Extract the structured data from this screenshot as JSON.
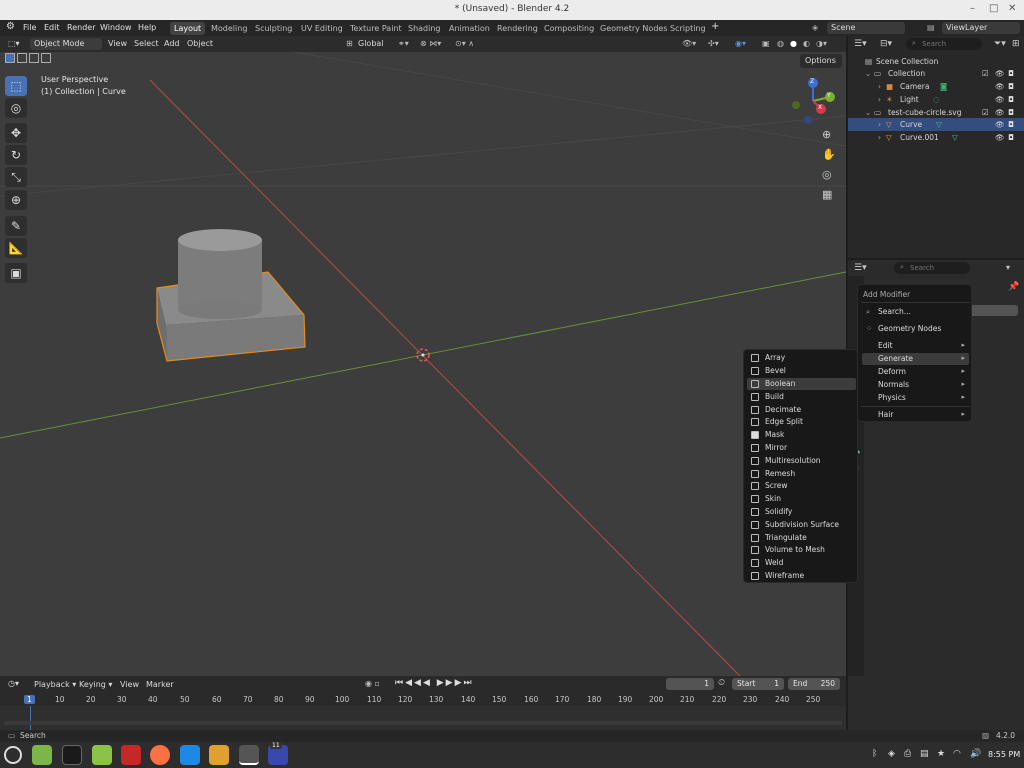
{
  "window": {
    "title": "* (Unsaved) - Blender 4.2"
  },
  "menubar": {
    "items": [
      "File",
      "Edit",
      "Render",
      "Window",
      "Help"
    ],
    "workspaces": [
      "Layout",
      "Modeling",
      "Sculpting",
      "UV Editing",
      "Texture Paint",
      "Shading",
      "Animation",
      "Rendering",
      "Compositing",
      "Geometry Nodes",
      "Scripting"
    ],
    "active_workspace": "Layout",
    "add_workspace": "+",
    "scene": "Scene",
    "view_layer": "ViewLayer"
  },
  "viewport": {
    "mode": "Object Mode",
    "menus": [
      "View",
      "Select",
      "Add",
      "Object"
    ],
    "orientation": "Global",
    "overlay_label": "User Perspective",
    "collection_label": "(1) Collection | Curve",
    "options_label": "Options",
    "gizmo_axes": [
      "X",
      "Y",
      "Z"
    ]
  },
  "outliner": {
    "search_placeholder": "Search",
    "rows": [
      {
        "label": "Scene Collection",
        "indent": 0,
        "selected": false
      },
      {
        "label": "Collection",
        "indent": 1,
        "selected": false
      },
      {
        "label": "Camera",
        "indent": 2,
        "selected": false
      },
      {
        "label": "Light",
        "indent": 2,
        "selected": false
      },
      {
        "label": "test-cube-circle.svg",
        "indent": 1,
        "selected": false
      },
      {
        "label": "Curve",
        "indent": 2,
        "selected": true
      },
      {
        "label": "Curve.001",
        "indent": 2,
        "selected": false
      }
    ]
  },
  "properties": {
    "search_placeholder": "Search"
  },
  "add_modifier_menu": {
    "title": "Add Modifier",
    "search": "Search...",
    "geometry_nodes": "Geometry Nodes",
    "categories": [
      "Edit",
      "Generate",
      "Deform",
      "Normals",
      "Physics"
    ],
    "hair": "Hair",
    "highlighted": "Generate"
  },
  "generate_menu": {
    "items": [
      "Array",
      "Bevel",
      "Boolean",
      "Build",
      "Decimate",
      "Edge Split",
      "Mask",
      "Mirror",
      "Multiresolution",
      "Remesh",
      "Screw",
      "Skin",
      "Solidify",
      "Subdivision Surface",
      "Triangulate",
      "Volume to Mesh",
      "Weld",
      "Wireframe"
    ],
    "highlighted": "Boolean"
  },
  "timeline": {
    "menus": [
      "Playback",
      "Keying",
      "View",
      "Marker"
    ],
    "current_frame": "1",
    "start_label": "Start",
    "start": "1",
    "end_label": "End",
    "end": "250",
    "ticks": [
      "1",
      "10",
      "20",
      "30",
      "40",
      "50",
      "60",
      "70",
      "80",
      "90",
      "100",
      "110",
      "120",
      "130",
      "140",
      "150",
      "160",
      "170",
      "180",
      "190",
      "200",
      "210",
      "220",
      "230",
      "240",
      "250"
    ]
  },
  "statusbar": {
    "left": "Search",
    "version": "4.2.0"
  },
  "taskbar": {
    "clock": "8:55 PM",
    "badge": "11"
  }
}
